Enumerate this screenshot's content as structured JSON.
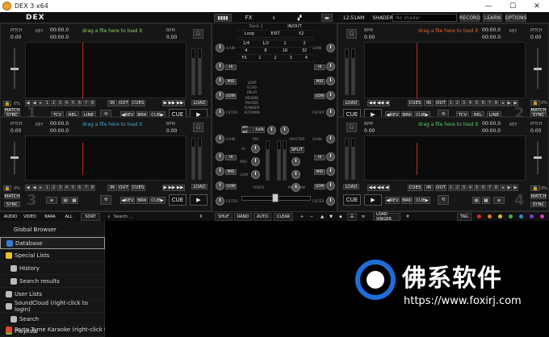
{
  "window": {
    "title": "DEX 3 x64",
    "min": "—",
    "max": "☐",
    "close": "✕"
  },
  "topbar": {
    "logo": "DEX",
    "fx": "FX",
    "time": "12:51AM",
    "shader_label": "SHADER",
    "shader_value": "No shader",
    "record": "RECORD",
    "learn": "LEARN",
    "options": "OPTIONS"
  },
  "deck": {
    "pitch": "PITCH",
    "pitch_val": "0.00",
    "key": "KEY",
    "bpm": "BPM",
    "bpm_val": "0.00",
    "time": "00:00.0",
    "drop": "drag a file here to load it",
    "load": "LOAD",
    "cues": "CUES",
    "in": "IN",
    "out": "OUT",
    "match": "MATCH",
    "sync": "SYNC",
    "tcv": "TCV",
    "rel": "REL",
    "line": "LINE",
    "rev": "◀REV",
    "brk": "BRK",
    "cue_arrow": "CUE▶",
    "cue": "CUE",
    "play": "▶",
    "pct": "0%",
    "cue_nums": [
      "1",
      "2",
      "3",
      "4",
      "5",
      "6",
      "7",
      "8"
    ],
    "gain": "GAIN",
    "hi": "HI",
    "mid": "MID",
    "low": "LOW",
    "filter": "FILTER"
  },
  "deck_numbers": {
    "d1": "1",
    "d2": "2",
    "d3": "3",
    "d4": "4"
  },
  "mixer": {
    "deck_label": "Deck 1",
    "loop": "Loop",
    "inout": "IN/OUT",
    "exit": "EXIT",
    "x2": "X2",
    "loop_sizes": [
      "1/4",
      "1/2",
      "1",
      "2",
      "4",
      "8",
      "16",
      "32"
    ],
    "fx": "FX",
    "fx_slots": [
      "1",
      "2",
      "3",
      "4"
    ],
    "effects": [
      "LOOP",
      "ECHO",
      "DELAY",
      "REVERB",
      "PHASER",
      "FLANGER",
      "AUTOPAN"
    ],
    "on_air": "on air",
    "talk": "talk",
    "mic": "MIC",
    "master": "MASTER",
    "split": "SPLIT",
    "video": "VIDEO",
    "mix_now": "MIX NOW",
    "hi": "HI",
    "mid": "MID",
    "low": "LOW"
  },
  "bottombar": {
    "audio": "AUDIO",
    "video": "VIDEO",
    "kara": "KARA",
    "all": "ALL",
    "sort": "SORT",
    "search_placeholder": "Search ...",
    "search_x": "X",
    "shuf": "SHUF",
    "rand": "RAND",
    "auto": "AUTO",
    "clear": "CLEAR",
    "plus": "+",
    "minus": "−",
    "load_singer": "LOAD SINGER",
    "tag": "TAG",
    "colors": [
      "#d62b2b",
      "#e07a1f",
      "#d8c21f",
      "#38b347",
      "#2a8fd6",
      "#7a3fd6",
      "#d63fae"
    ]
  },
  "browser": {
    "items": [
      {
        "label": "Global Browser",
        "icon": "none",
        "color": ""
      },
      {
        "label": "Database",
        "icon": "database-icon",
        "color": "#3a7fd6"
      },
      {
        "label": "Special Lists",
        "icon": "star-icon",
        "color": "#e8c41f"
      },
      {
        "label": "History",
        "icon": "clock-icon",
        "color": "#bbbbbb"
      },
      {
        "label": "Search results",
        "icon": "search-icon",
        "color": "#bbbbbb"
      },
      {
        "label": "User Lists",
        "icon": "user-list-icon",
        "color": "#bbbbbb"
      },
      {
        "label": "SoundCloud (right-click to login)",
        "icon": "cloud-icon",
        "color": "#bbbbbb"
      },
      {
        "label": "Search",
        "icon": "search-icon",
        "color": "#bbbbbb"
      },
      {
        "label": "Playlists",
        "icon": "playlist-icon",
        "color": "#7fbf3a"
      },
      {
        "label": "Party Tyme Karaoke (right-click to",
        "icon": "karaoke-icon",
        "color": "#d84a2a"
      }
    ]
  },
  "watermark": {
    "cn": "佛系软件",
    "url": "https://www.foxirj.com"
  }
}
